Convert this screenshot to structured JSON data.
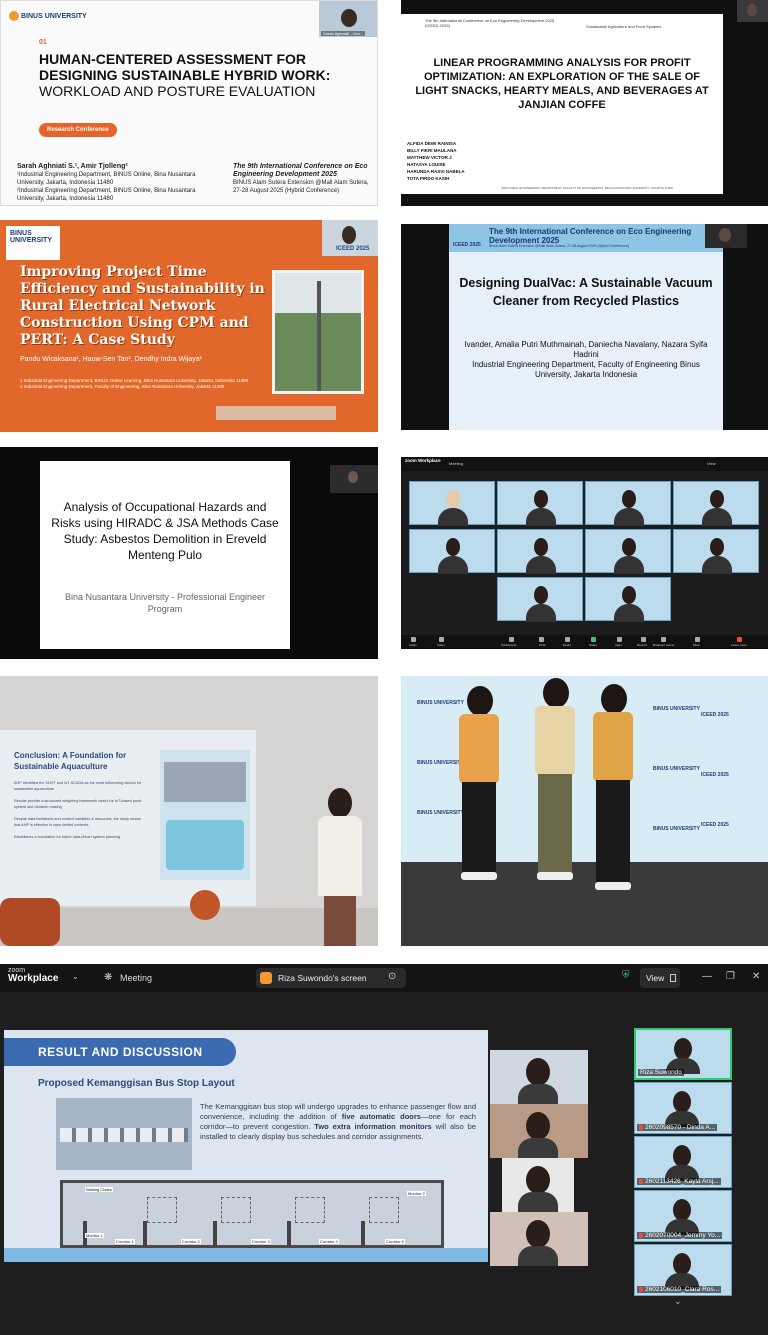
{
  "tile1": {
    "logo": "BINUS UNIVERSITY",
    "num": "01",
    "title_bold": "HUMAN-CENTERED ASSESSMENT FOR DESIGNING SUSTAINABLE HYBRID WORK:",
    "title_light": " WORKLOAD AND POSTURE EVALUATION",
    "badge": "Research Conference",
    "authors": "Sarah Aghniati S.¹, Amir Tjolleng²",
    "aff1": "¹Industrial Engineering Department, BINUS Online, Bina Nusantara University, Jakarta, Indonesia 11480",
    "aff2": "²Industrial Engineering Department, BINUS Online, Bina Nusantara University, Jakarta, Indonesia 11480",
    "conf_title": "The 9th International Conference on Eco Engineering Development 2025",
    "conf_place": "BINUS Alam Sutera Extension @Mall Alam Sutera, 27-28 August 2025 (Hybrid Conference)",
    "cam_label": "Sarah Aghniati - Ovo..."
  },
  "tile2": {
    "header": "The 9th International Conference on Eco Engineering Development 2025 (ICEED 2025)",
    "sub": "Sustainable Agriculture and Food Systems",
    "title": "LINEAR PROGRAMMING ANALYSIS FOR PROFIT OPTIMIZATION: AN EXPLORATION OF THE SALE OF LIGHT SNACKS, HEARTY MEALS, AND BEVERAGES AT JANJIAN COFFE",
    "names": [
      "ALFIDA DEWI RAINISA",
      "BILLY FIKRI MAULANA",
      "MATTHEW VICTOR J",
      "NATASYA LOUISE",
      "HARUNDA RASVI NABELA",
      "TOTA PIRDO KASIH"
    ],
    "footer": "INDUSTRIAL ENGINEERING DEPARTMENT, FACULTY OF ENGINEERING, BINA NUSANTARA UNIVERSITY, JAKARTA 11480"
  },
  "tile3": {
    "logo": "BINUS UNIVERSITY",
    "title": "Improving Project Time Efficiency and Sustainability in Rural Electrical Network Construction Using CPM and PERT: A Case Study",
    "authors": "Pandu Wicaksana¹, Hauw-Sen Tan², Dendhy Indra Wijaya¹",
    "aff1": "1 Industrial Engineering Department, BINUS Online Learning, Bina Nusantara University, Jakarta, Indonesia 11480",
    "aff2": "2 Industrial Engineering Department, Faculty of Engineering, Bina Nusantara University, Jakarta 11480",
    "cam_label": "ICEED 2025"
  },
  "tile4": {
    "banner": "The 9th International Conference on Eco Engineering Development 2025",
    "banner_small": "Binus Alam Sutera Extension @Mall Alam Sutera, 27-28 August 2025 (Hybrid Conference)",
    "iceed": "ICEED 2025",
    "title": "Designing DualVac: A Sustainable Vacuum Cleaner from Recycled Plastics",
    "authors": "Ivander, Amalia Putri Muthmainah, Daniecha Navalany, Nazara Syifa Hadrini",
    "dept": "Industrial Engineering Department, Faculty of Engineering Binus University, Jakarta Indonesia"
  },
  "tile5": {
    "title": "Analysis of Occupational Hazards and Risks using HIRADC & JSA Methods Case Study: Asbestos Demolition in Ereveld Menteng Pulo",
    "inst": "Bina Nusantara University - Professional Engineer Program"
  },
  "tile6": {
    "app": "zoom Workplace",
    "meeting": "Meeting",
    "view": "View",
    "toolbar": [
      "Audio",
      "Video",
      "Participants",
      "Chat",
      "React",
      "Share",
      "Apps",
      "Record",
      "Breakout rooms",
      "More",
      "Leave room"
    ]
  },
  "tile7": {
    "title": "Conclusion: A Foundation for Sustainable Aquaculture",
    "bullets": [
      "AHP identified the SUHT and IoT-SCADA as the most influencing factors for sustainable aquaculture",
      "Results provide a structured weighting framework useful for IoT-based pond system and decision making",
      "Despite data limitations and context variables & resources, the study shows that AHP is effective in case-limited contexts",
      "Establishes a foundation for future data-driven system planning"
    ]
  },
  "tile8": {
    "logo": "BINUS UNIVERSITY",
    "iceed": "ICEED 2025"
  },
  "tile9": {
    "app_top": "zoom",
    "app_name": "Workplace",
    "meeting": "Meeting",
    "screen_share": "Riza Suwondo's screen",
    "view": "View",
    "slide_header": "RESULT AND DISCUSSION",
    "slide_sub": "Proposed Kemanggisan Bus Stop Layout",
    "para_1": "The Kemanggisan bus stop will undergo upgrades to enhance passenger flow and convenience, including the addition of ",
    "para_b1": "five automatic doors",
    "para_2": "—one for each corridor—to prevent congestion. ",
    "para_b2": "Two extra information monitors",
    "para_3": " will also be installed to clearly display bus schedules and corridor assignments.",
    "plan_labels": [
      "Waiting Chairs",
      "Monitor 1",
      "Corridor 1",
      "Corridor 2",
      "Corridor 3",
      "Corridor 4",
      "Corridor 5",
      "Monitor 2"
    ],
    "participants": [
      "Riza Suwondo",
      "2602098570 - Dinda A...",
      "2602113426_Kayla Arsj...",
      "2602070004_Jemmy Yo...",
      "2602106010_Clara Ros..."
    ]
  }
}
